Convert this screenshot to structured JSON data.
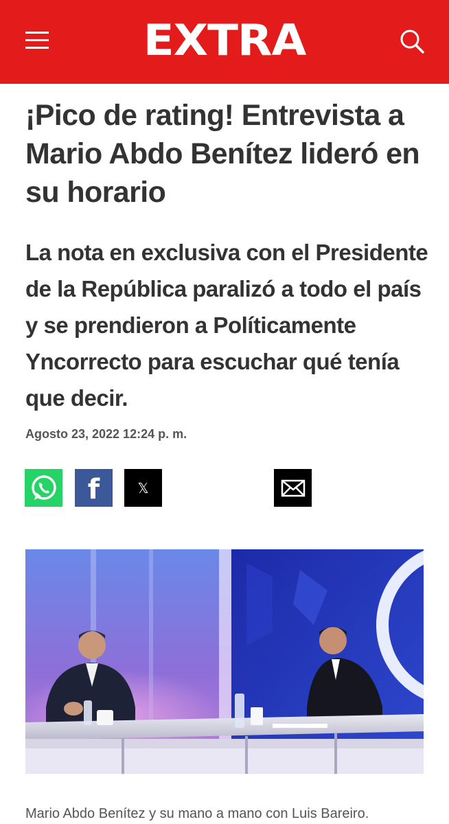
{
  "header": {
    "logo_text": "EXTRA",
    "menu_icon": "hamburger-menu-icon",
    "search_icon": "search-icon",
    "background_color": "#e31b1b"
  },
  "article": {
    "title": "¡Pico de rating! Entrevista a Mario Abdo Benítez lideró en su horario",
    "subtitle": "La nota en exclusiva con el Presidente de la República paralizó a todo el país y se prendieron a Políticamente Yncorrecto para escuchar qué tenía que decir.",
    "date": "Agosto 23, 2022 12:24 p. m.",
    "share": [
      {
        "name": "whatsapp",
        "icon": "whatsapp-icon",
        "color": "#25d366"
      },
      {
        "name": "facebook",
        "icon": "facebook-icon",
        "color": "#3b5998"
      },
      {
        "name": "x",
        "icon": "x-icon",
        "color": "#000000"
      },
      {
        "name": "email",
        "icon": "mail-icon",
        "color": "#000000"
      }
    ],
    "image": {
      "caption": "Mario Abdo Benítez y su mano a mano con Luis Bareiro."
    }
  }
}
